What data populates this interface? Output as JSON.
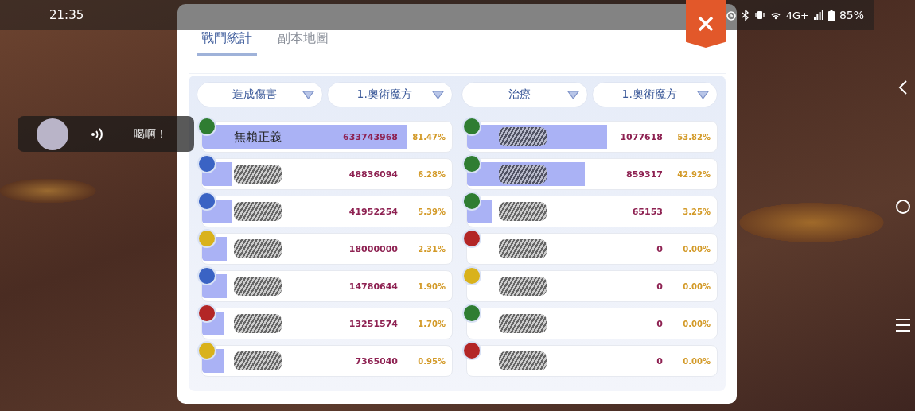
{
  "status_bar": {
    "time": "21:35",
    "network": "4G+",
    "battery": "85%"
  },
  "chat_bubble": {
    "message": "喝啊！"
  },
  "tabs": [
    {
      "label": "戰鬥統計",
      "selected": true
    },
    {
      "label": "副本地圖",
      "selected": false
    }
  ],
  "panels": [
    {
      "dropdowns": [
        "造成傷害",
        "1.奧術魔方"
      ],
      "rows": [
        {
          "name": "無賴正義",
          "redacted": false,
          "color": "#2f7d32",
          "value": "633743968",
          "percent": "81.47%",
          "level": 0.82
        },
        {
          "redacted": true,
          "color": "#3a63c4",
          "value": "48836094",
          "percent": "6.28%",
          "level": 0.12
        },
        {
          "redacted": true,
          "color": "#3a63c4",
          "value": "41952254",
          "percent": "5.39%",
          "level": 0.12
        },
        {
          "redacted": true,
          "color": "#d9b21c",
          "value": "18000000",
          "percent": "2.31%",
          "level": 0.1
        },
        {
          "redacted": true,
          "color": "#3a63c4",
          "value": "14780644",
          "percent": "1.90%",
          "level": 0.1
        },
        {
          "redacted": true,
          "color": "#b32626",
          "value": "13251574",
          "percent": "1.70%",
          "level": 0.09
        },
        {
          "redacted": true,
          "color": "#d9b21c",
          "value": "7365040",
          "percent": "0.95%",
          "level": 0.09
        }
      ]
    },
    {
      "dropdowns": [
        "治療",
        "1.奧術魔方"
      ],
      "rows": [
        {
          "redacted": true,
          "color": "#2f7d32",
          "value": "1077618",
          "percent": "53.82%",
          "level": 0.56
        },
        {
          "redacted": true,
          "color": "#2f7d32",
          "value": "859317",
          "percent": "42.92%",
          "level": 0.47
        },
        {
          "redacted": true,
          "color": "#2f7d32",
          "value": "65153",
          "percent": "3.25%",
          "level": 0.1
        },
        {
          "redacted": true,
          "color": "#b32626",
          "value": "0",
          "percent": "0.00%",
          "level": 0
        },
        {
          "redacted": true,
          "color": "#d9b21c",
          "value": "0",
          "percent": "0.00%",
          "level": 0
        },
        {
          "redacted": true,
          "color": "#2f7d32",
          "value": "0",
          "percent": "0.00%",
          "level": 0
        },
        {
          "redacted": true,
          "color": "#b32626",
          "value": "0",
          "percent": "0.00%",
          "level": 0
        }
      ]
    }
  ]
}
